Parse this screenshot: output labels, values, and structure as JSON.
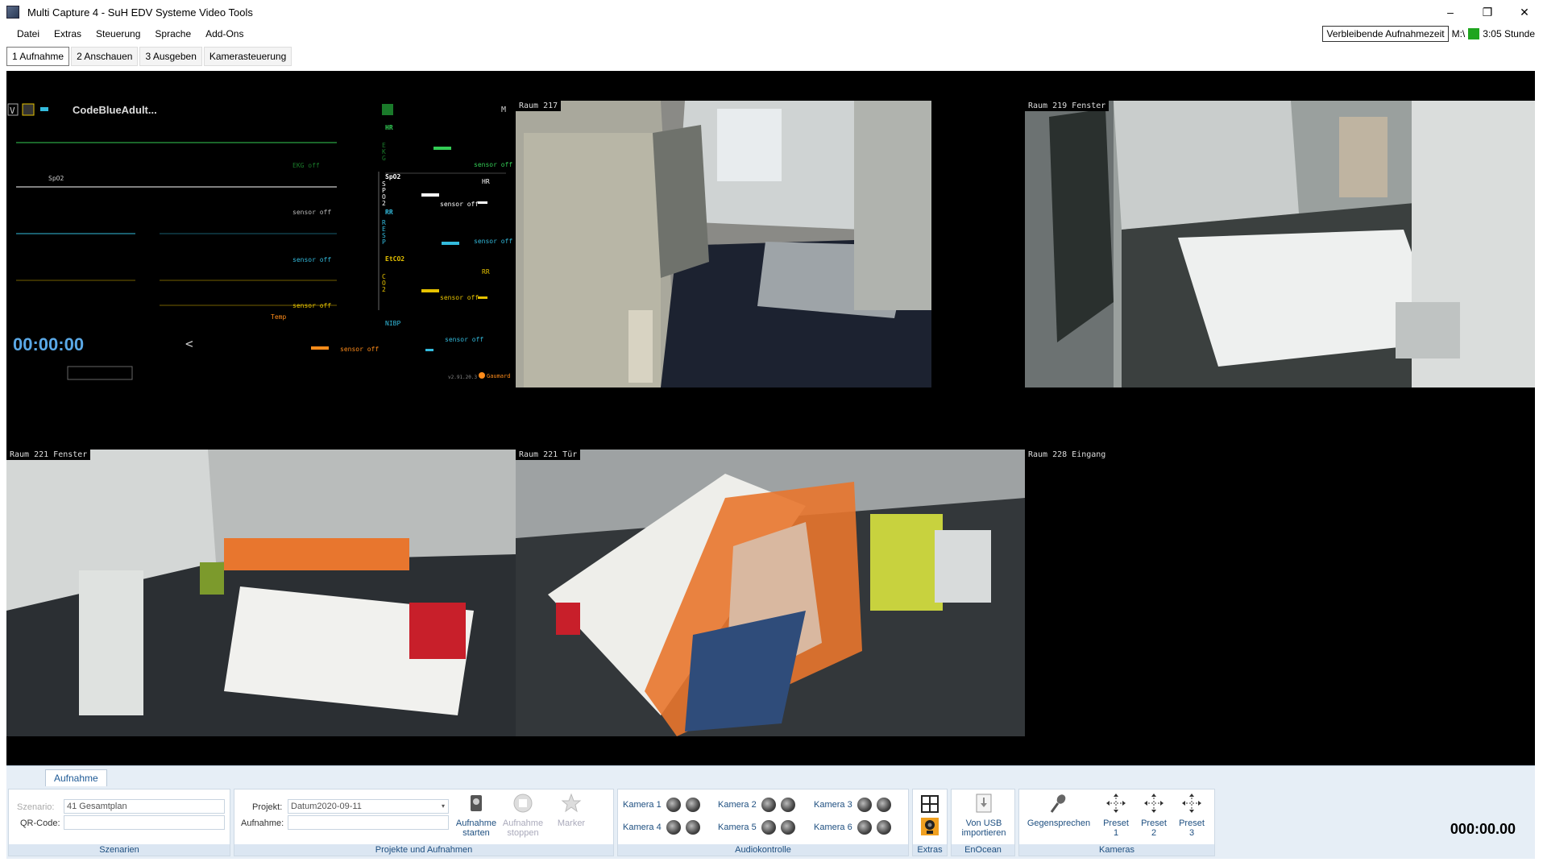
{
  "window": {
    "title": "Multi Capture 4 - SuH EDV Systeme Video Tools",
    "minimize": "–",
    "restore": "❐",
    "close": "✕"
  },
  "menu": {
    "items": [
      "Datei",
      "Extras",
      "Steuerung",
      "Sprache",
      "Add-Ons"
    ]
  },
  "recording": {
    "remaining_label": "Verbleibende Aufnahmezeit",
    "drive": "M:\\",
    "remaining_value": "3:05 Stunde"
  },
  "tabs": [
    "1 Aufnahme",
    "2 Anschauen",
    "3 Ausgeben",
    "Kamerasteuerung"
  ],
  "monitor": {
    "title": "CodeBlueAdult...",
    "v_label": "V",
    "m_label": "M",
    "spo2": "SpO2",
    "hr": "HR",
    "rr": "RR",
    "etco2": "EtCO2",
    "nibp": "NIBP",
    "temp": "Temp",
    "sensor_off": "sensor off",
    "ekg_off": "EKG off",
    "timer": "00:00:00",
    "arrow": "<",
    "dashes": "- -",
    "vert_ekg": "EKG",
    "vert_spo2": "SPO2",
    "vert_resp": "RESP",
    "vert_co2": "CO2",
    "version": "v2.91.20.3",
    "brand": "Gaumard"
  },
  "cameras": [
    {
      "label": "Raum 217"
    },
    {
      "label": "Raum 219 Fenster"
    },
    {
      "label": "Raum 221 Fenster"
    },
    {
      "label": "Raum 221 Tür"
    },
    {
      "label": "Raum 228 Eingang"
    }
  ],
  "panel": {
    "tab": "Aufnahme",
    "szenario_label": "Szenario:",
    "szenario_value": "41 Gesamtplan",
    "qr_label": "QR-Code:",
    "qr_value": "",
    "szenarien_caption": "Szenarien",
    "projekt_label": "Projekt:",
    "projekt_value": "Datum2020-09-11",
    "aufnahme_label": "Aufnahme:",
    "aufnahme_value": "",
    "start_label_1": "Aufnahme",
    "start_label_2": "starten",
    "stop_label_1": "Aufnahme",
    "stop_label_2": "stoppen",
    "marker_label": "Marker",
    "projekte_caption": "Projekte und Aufnahmen",
    "audio_caption": "Audiokontrolle",
    "kamera_labels": [
      "Kamera 1",
      "Kamera 2",
      "Kamera 3",
      "Kamera 4",
      "Kamera 5",
      "Kamera 6"
    ],
    "extras_caption": "Extras",
    "usb_label_1": "Von USB",
    "usb_label_2": "importieren",
    "enocean_caption": "EnOcean",
    "gegensprechen": "Gegensprechen",
    "preset1": "Preset",
    "preset1n": "1",
    "preset2": "Preset",
    "preset2n": "2",
    "preset3": "Preset",
    "preset3n": "3",
    "kameras_caption": "Kameras",
    "timer": "000:00.00"
  },
  "colors": {
    "accent": "#1e4f80",
    "panel_bg": "#e6eef6",
    "remaining_indicator": "#1fa51f",
    "monitor_green": "#33cc55",
    "monitor_yellow": "#e6c200",
    "monitor_cyan": "#33bbdd",
    "monitor_orange": "#ff8c1a"
  }
}
